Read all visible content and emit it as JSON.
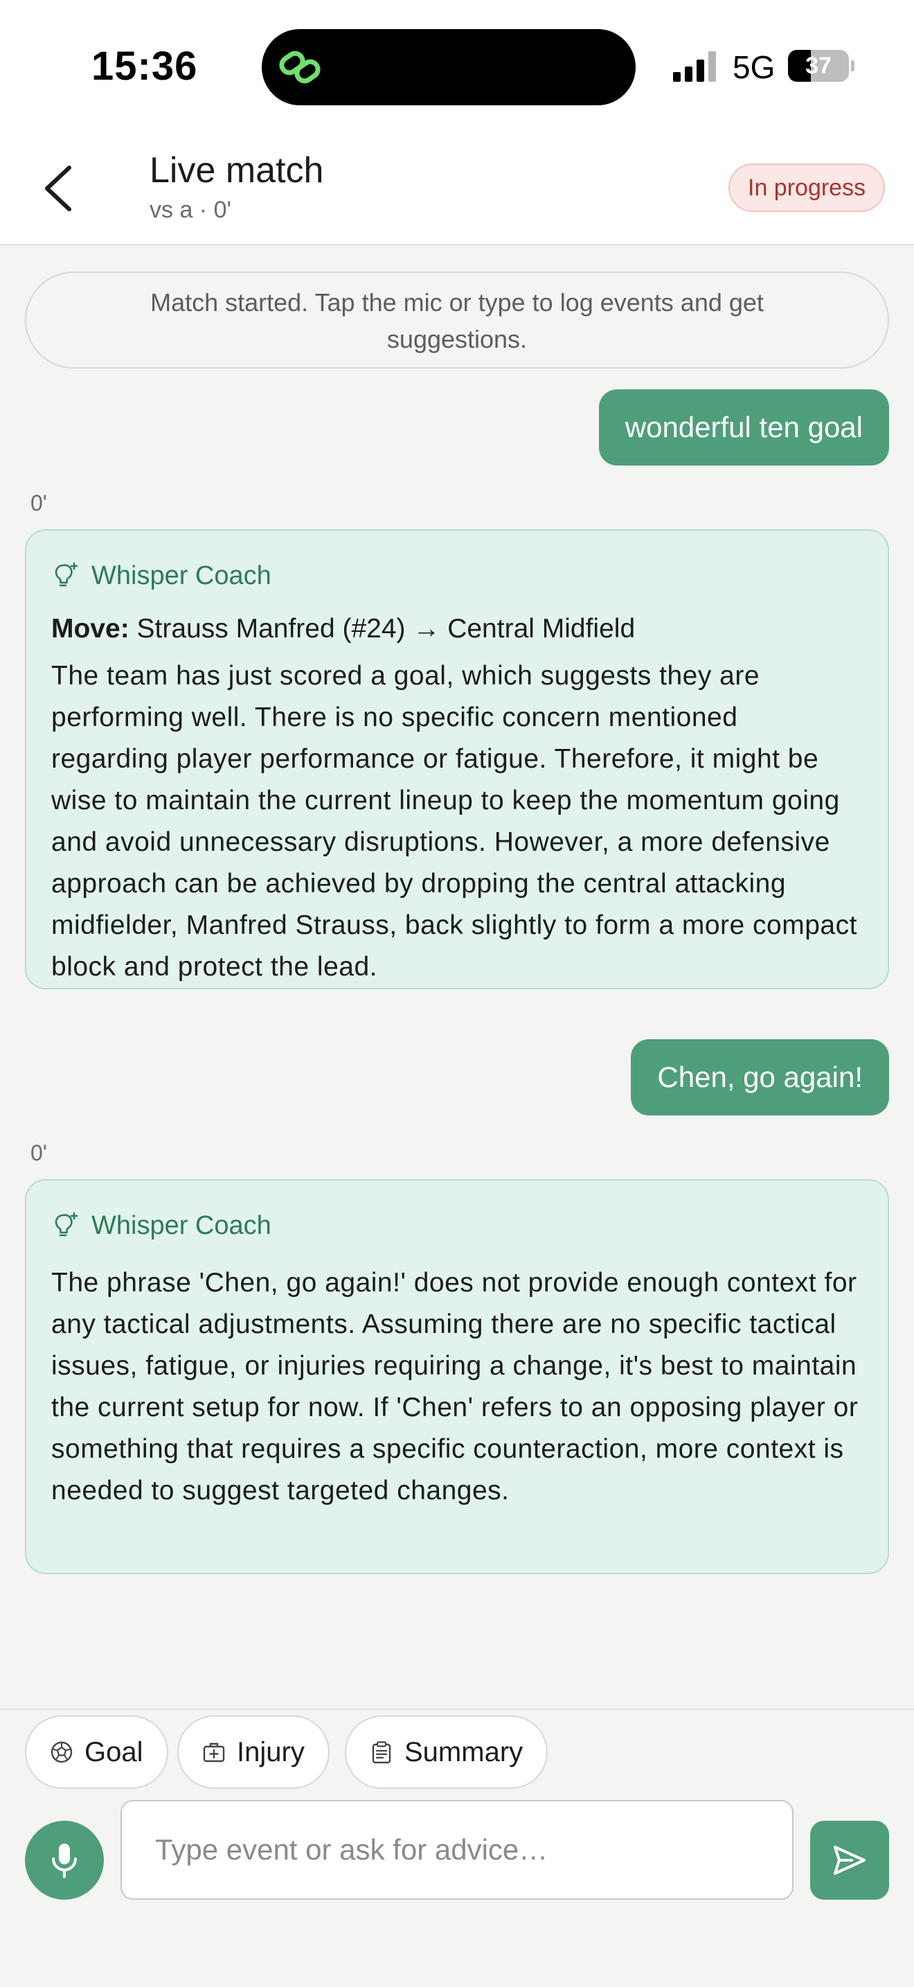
{
  "status_bar": {
    "time": "15:36",
    "network": "5G",
    "battery_percent": 37,
    "battery_label": "37",
    "island_icon": "link-icon"
  },
  "header": {
    "back_icon": "chevron-left-icon",
    "title": "Live match",
    "subtitle": "vs a · 0'",
    "status_badge": "In progress"
  },
  "feed": {
    "system_note": "Match started. Tap the mic or type to log events and get suggestions.",
    "messages": [
      {
        "type": "user",
        "text": "wonderful ten goal"
      },
      {
        "type": "coach",
        "timestamp": "0'",
        "sender": "Whisper Coach",
        "move_label": "Move:",
        "move_text": "Strauss Manfred (#24) → Central Midfield",
        "body": "The team has just scored a goal, which suggests they are performing well. There is no specific concern mentioned regarding player performance or fatigue. Therefore, it might be wise to maintain the current lineup to keep the momentum going and avoid unnecessary disruptions. However, a more defensive approach can be achieved by dropping the central attacking midfielder, Manfred Strauss, back slightly to form a more compact block and protect the lead."
      },
      {
        "type": "user",
        "text": "Chen, go again!"
      },
      {
        "type": "coach",
        "timestamp": "0'",
        "sender": "Whisper Coach",
        "body": "The phrase 'Chen, go again!' does not provide enough context for any tactical adjustments. Assuming there are no specific tactical issues, fatigue, or injuries requiring a change, it's best to maintain the current setup for now. If 'Chen' refers to an opposing player or something that requires a specific counteraction, more context is needed to suggest targeted changes."
      }
    ]
  },
  "quick_actions": [
    {
      "label": "Goal",
      "icon": "soccer-ball-icon"
    },
    {
      "label": "Injury",
      "icon": "first-aid-kit-icon"
    },
    {
      "label": "Summary",
      "icon": "clipboard-icon"
    }
  ],
  "composer": {
    "placeholder": "Type event or ask for advice…",
    "value": "",
    "mic_icon": "microphone-icon",
    "send_icon": "send-icon"
  },
  "colors": {
    "accent": "#4f9e7a",
    "coach_card_bg": "#e1f3ec",
    "badge_bg": "#fbe7e6",
    "badge_text": "#a8332d"
  }
}
